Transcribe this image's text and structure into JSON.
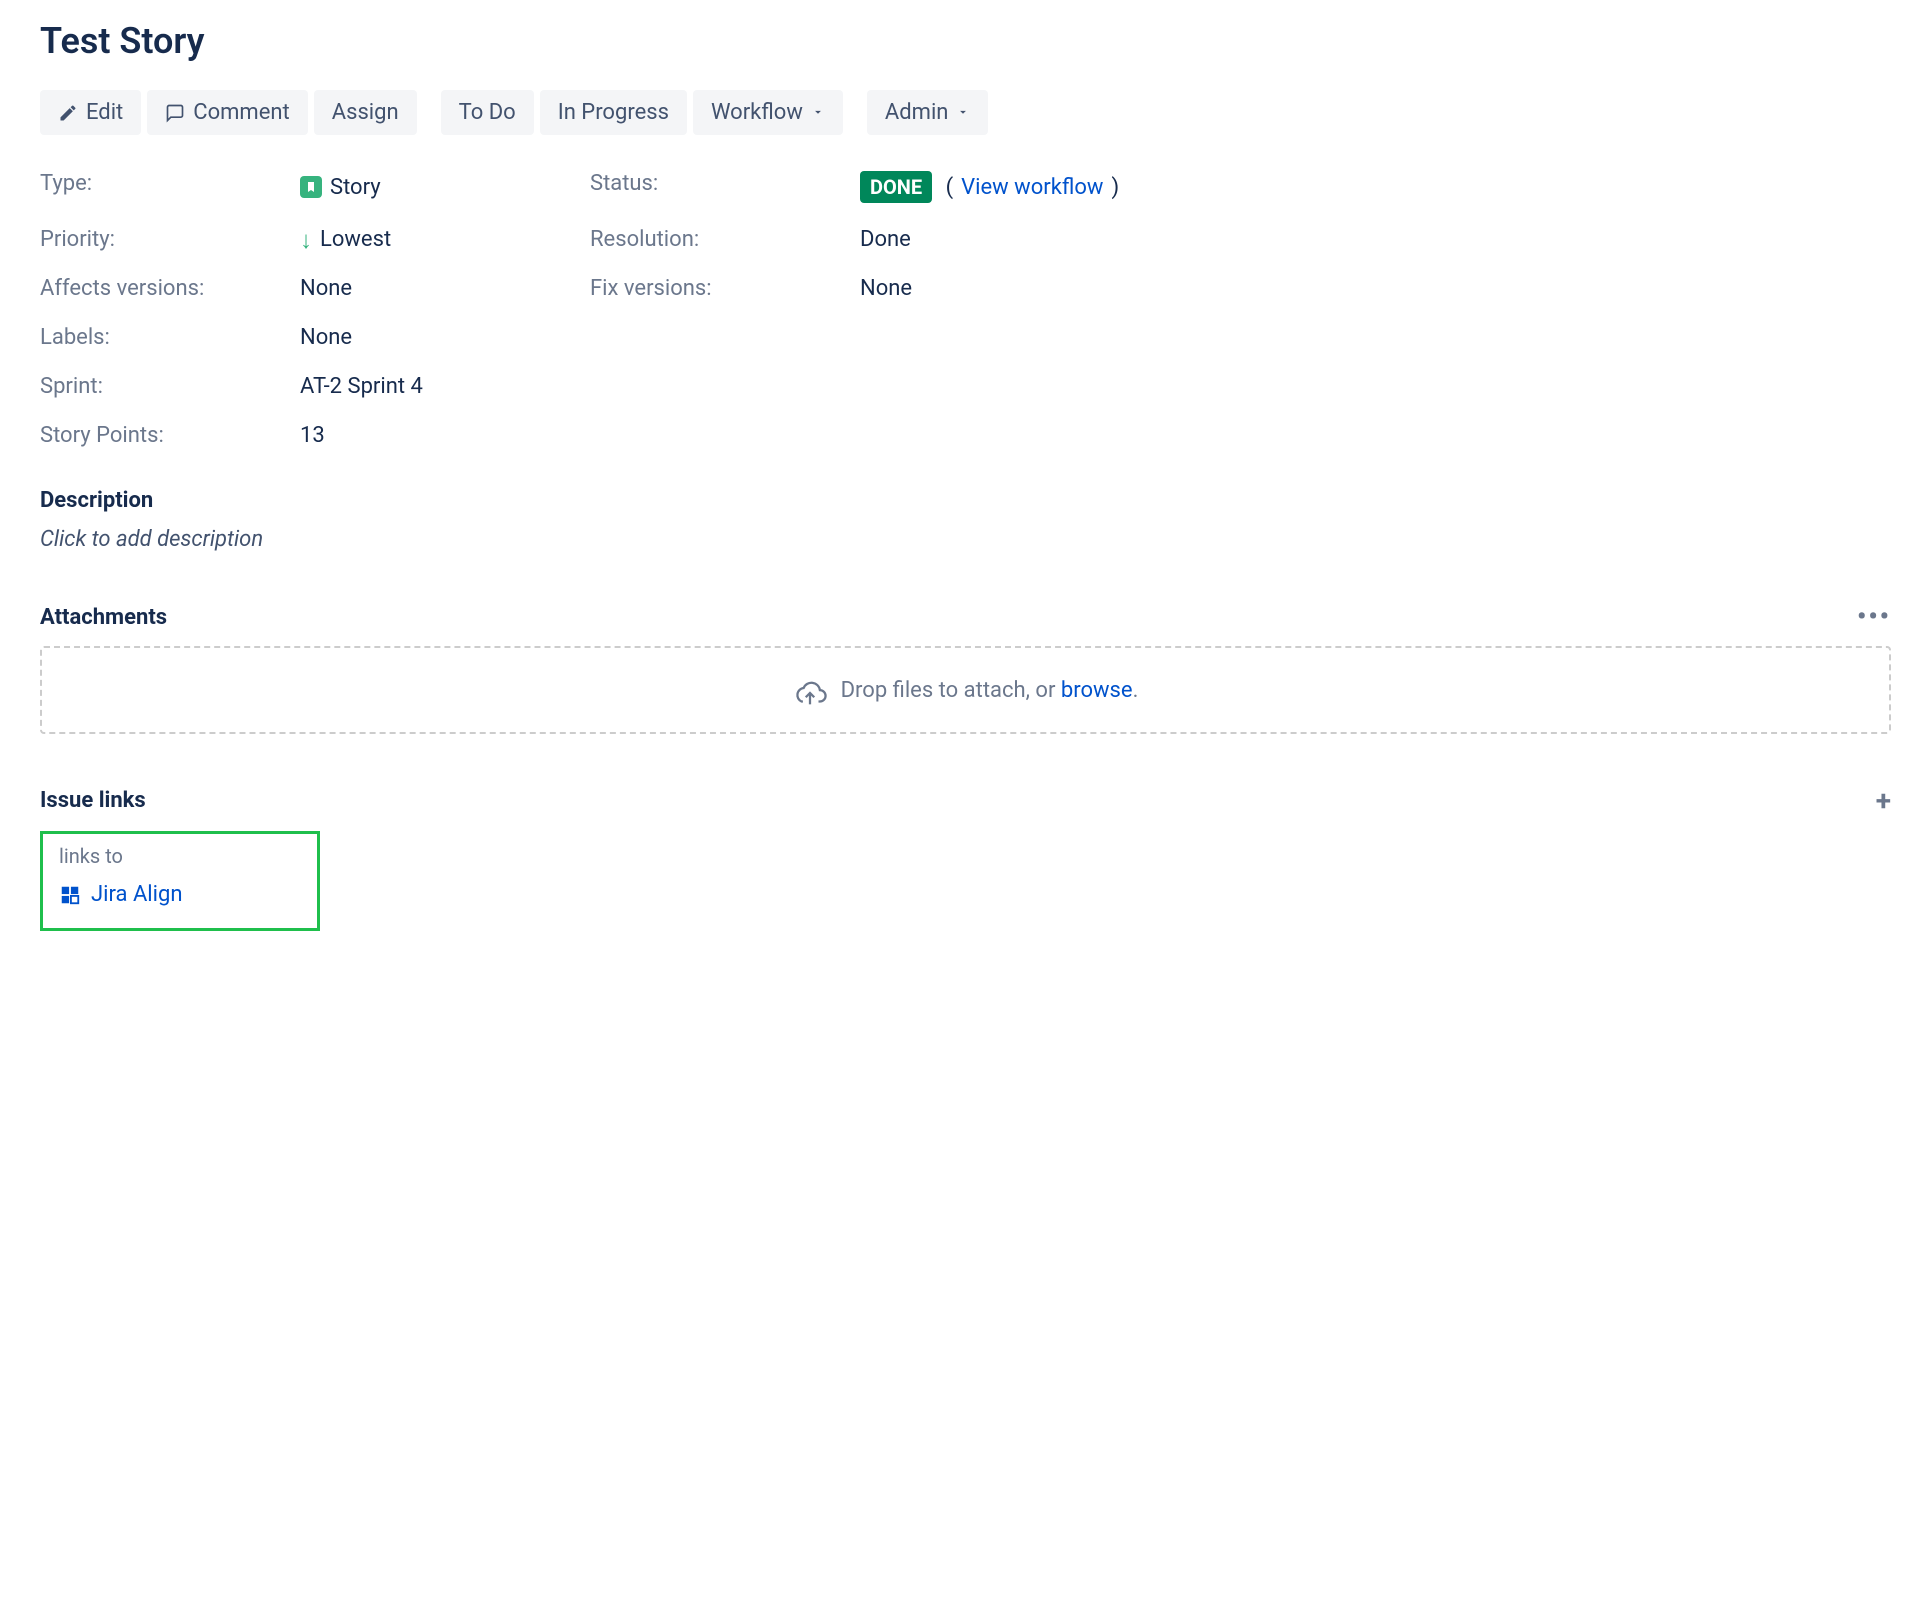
{
  "page_title": "Test Story",
  "toolbar": {
    "edit": "Edit",
    "comment": "Comment",
    "assign": "Assign",
    "todo": "To Do",
    "in_progress": "In Progress",
    "workflow": "Workflow",
    "admin": "Admin"
  },
  "fields": {
    "type_label": "Type:",
    "type_value": "Story",
    "status_label": "Status:",
    "status_value": "DONE",
    "view_workflow": "View workflow",
    "priority_label": "Priority:",
    "priority_value": "Lowest",
    "resolution_label": "Resolution:",
    "resolution_value": "Done",
    "affects_label": "Affects versions:",
    "affects_value": "None",
    "fix_label": "Fix versions:",
    "fix_value": "None",
    "labels_label": "Labels:",
    "labels_value": "None",
    "sprint_label": "Sprint:",
    "sprint_value": "AT-2 Sprint 4",
    "points_label": "Story Points:",
    "points_value": "13"
  },
  "description": {
    "header": "Description",
    "placeholder": "Click to add description"
  },
  "attachments": {
    "header": "Attachments",
    "drop_text": "Drop files to attach, or ",
    "browse": "browse",
    "dot": "."
  },
  "issue_links": {
    "header": "Issue links",
    "links_to": "links to",
    "jira_align": "Jira Align"
  }
}
